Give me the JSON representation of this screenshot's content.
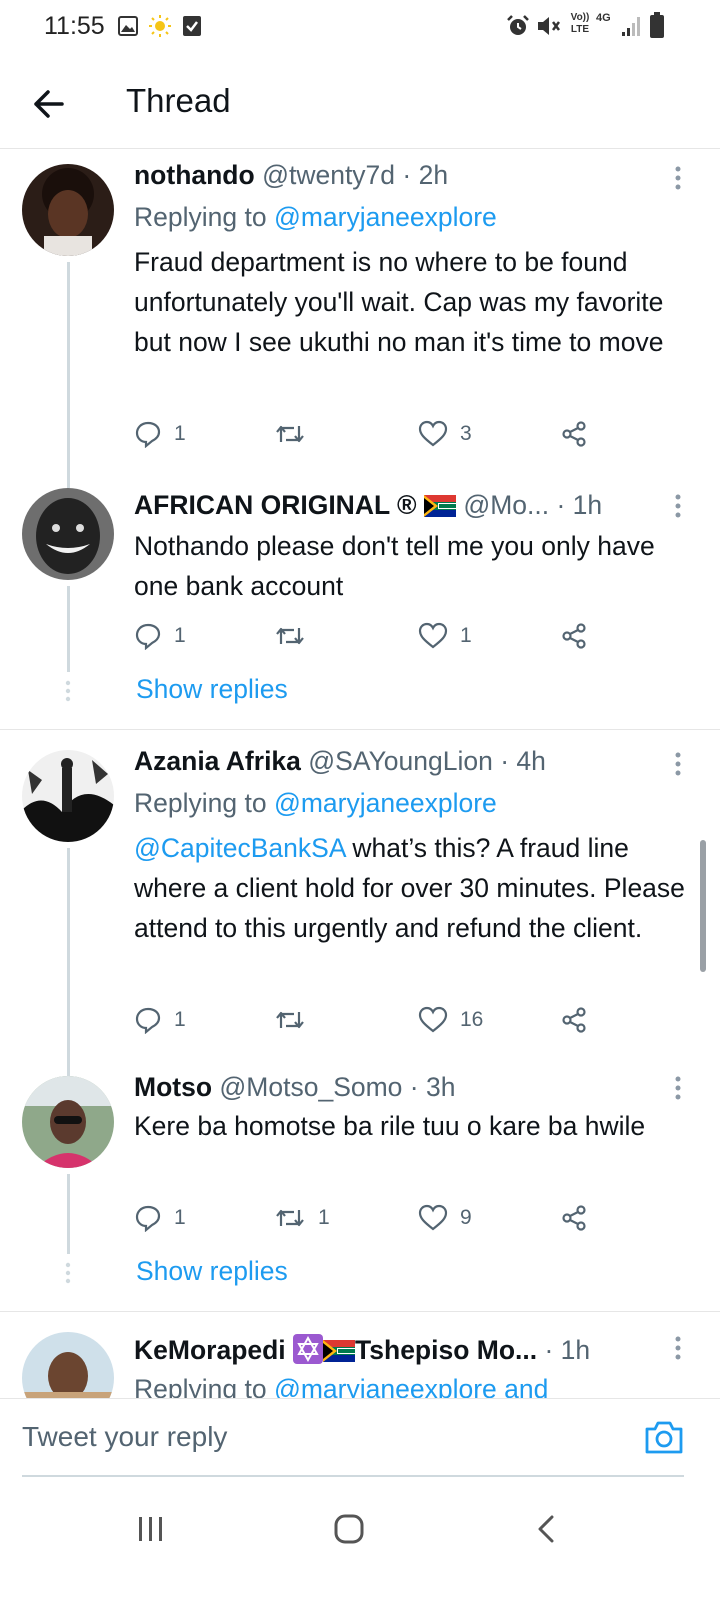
{
  "status_bar": {
    "time": "11:55",
    "volte": "Vo)) LTE",
    "network": "4G"
  },
  "header": {
    "title": "Thread"
  },
  "tweets": [
    {
      "name": "nothando",
      "handle": "@twenty7d",
      "time": "· 2h",
      "replying_label": "Replying to",
      "replying_to": "@maryjaneexplore",
      "text": "Fraud department is no where to be found unfortunately you'll wait. Cap was my favorite but now I see ukuthi no man it's time to move",
      "replies": "1",
      "retweets": "",
      "likes": "3"
    },
    {
      "name": "AFRICAN ORIGINAL ®",
      "handle": "@Mo...",
      "time": "· 1h",
      "text": "Nothando please don't tell me you only have one bank account",
      "replies": "1",
      "retweets": "",
      "likes": "1"
    },
    {
      "name": "Azania Afrika",
      "handle": "@SAYoungLion",
      "time": "· 4h",
      "replying_label": "Replying to",
      "replying_to": "@maryjaneexplore",
      "mention": "@CapitecBankSA",
      "text": " what’s this? A fraud line where a client hold for over 30 minutes. Please attend to this urgently and refund the client.",
      "replies": "1",
      "retweets": "",
      "likes": "16"
    },
    {
      "name": "Motso",
      "handle": "@Motso_Somo",
      "time": "· 3h",
      "text": "Kere ba homotse ba rile tuu o kare ba hwile",
      "replies": "1",
      "retweets": "1",
      "likes": "9"
    },
    {
      "name": "KeMorapedi",
      "name_rest": "Tshepiso Mo...",
      "time": "· 1h",
      "replying_label": "Replying to",
      "replying_to": "@maryjaneexplore and"
    }
  ],
  "show_replies_label": "Show replies",
  "compose": {
    "placeholder": "Tweet your reply"
  },
  "colors": {
    "accent": "#1d9bf0",
    "text": "#0f1419",
    "secondary": "#536471"
  }
}
